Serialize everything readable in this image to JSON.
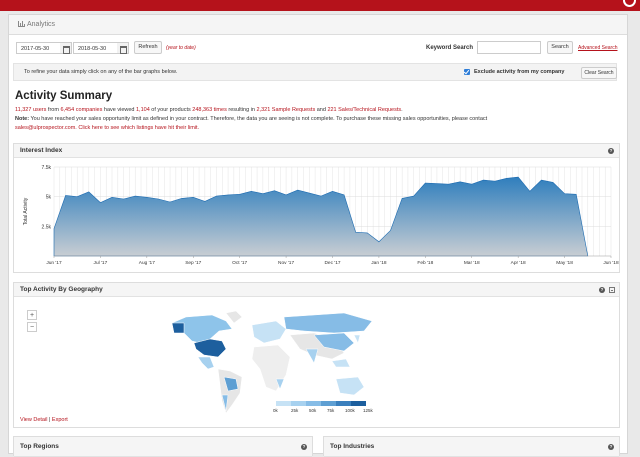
{
  "header": {
    "title": "Analytics"
  },
  "filters": {
    "start_date": "2017-05-30",
    "end_date": "2018-05-30",
    "refresh_label": "Refresh",
    "year_to_date": "(year to date)",
    "keyword_label": "Keyword Search",
    "keyword_value": "",
    "search_label": "Search",
    "advanced_search": "Advanced Search"
  },
  "notice": {
    "text": "To refine your data simply click on any of the bar graphs below.",
    "exclude_label": "Exclude activity from my company",
    "exclude_checked": true,
    "clear_label": "Clear Search"
  },
  "summary": {
    "title": "Activity Summary",
    "users": "11,327 users",
    "t1": " from ",
    "companies": "6,454 companies",
    "t2": " have viewed ",
    "products": "1,104",
    "t3": " of your products ",
    "times": "248,363 times",
    "t4": " resulting in ",
    "samples": "2,321 Sample Requests",
    "t5": " and ",
    "sales": "221 Sales/Technical Requests",
    "t6": ".",
    "note_label": "Note:",
    "note_text": " You have reached your sales opportunity limit as defined in your contract. Therefore, the data you are seeing is not complete. To purchase these missing sales opportunities, please contact",
    "contact": "sales@ulprospector.com. Click here to see which listings have hit their limit."
  },
  "interest": {
    "title": "Interest Index",
    "help": "?"
  },
  "chart_data": {
    "type": "area",
    "title": "Interest Index",
    "ylabel": "Total Activity",
    "xlabel": "",
    "ylim": [
      0,
      7500
    ],
    "yticks": [
      "2.5k",
      "5k",
      "7.5k"
    ],
    "xticks": [
      "Jun '17",
      "Jul '17",
      "Aug '17",
      "Sep '17",
      "Oct '17",
      "Nov '17",
      "Dec '17",
      "Jan '18",
      "Feb '18",
      "Mar '18",
      "Apr '18",
      "May '18",
      "Jun '18"
    ],
    "x_index_range": [
      0,
      12
    ],
    "points": [
      [
        0.0,
        2300
      ],
      [
        0.25,
        5100
      ],
      [
        0.5,
        5000
      ],
      [
        0.75,
        5400
      ],
      [
        1.0,
        4500
      ],
      [
        1.25,
        4950
      ],
      [
        1.5,
        4800
      ],
      [
        1.75,
        5050
      ],
      [
        2.0,
        4950
      ],
      [
        2.25,
        4800
      ],
      [
        2.5,
        4550
      ],
      [
        2.75,
        4850
      ],
      [
        3.0,
        4950
      ],
      [
        3.25,
        4600
      ],
      [
        3.5,
        5050
      ],
      [
        3.75,
        5150
      ],
      [
        4.0,
        5200
      ],
      [
        4.25,
        5450
      ],
      [
        4.5,
        5250
      ],
      [
        4.75,
        5500
      ],
      [
        5.0,
        5150
      ],
      [
        5.25,
        5550
      ],
      [
        5.5,
        5300
      ],
      [
        5.75,
        5050
      ],
      [
        6.0,
        5450
      ],
      [
        6.25,
        5150
      ],
      [
        6.5,
        2000
      ],
      [
        6.75,
        1950
      ],
      [
        7.0,
        1200
      ],
      [
        7.25,
        2150
      ],
      [
        7.5,
        4850
      ],
      [
        7.75,
        5050
      ],
      [
        8.0,
        6150
      ],
      [
        8.25,
        6100
      ],
      [
        8.5,
        6050
      ],
      [
        8.75,
        6250
      ],
      [
        9.0,
        6050
      ],
      [
        9.25,
        6400
      ],
      [
        9.5,
        6300
      ],
      [
        9.75,
        6550
      ],
      [
        10.0,
        6650
      ],
      [
        10.25,
        5450
      ],
      [
        10.5,
        6400
      ],
      [
        10.75,
        6200
      ],
      [
        11.0,
        5250
      ],
      [
        11.25,
        5200
      ],
      [
        11.5,
        0
      ]
    ],
    "color_top": "#2f7ebd",
    "color_bottom": "#c8cdd3"
  },
  "geo": {
    "title": "Top Activity By Geography",
    "help": "?",
    "zoom_in": "+",
    "zoom_out": "−",
    "legend_ticks": [
      "0k",
      "25k",
      "50k",
      "75k",
      "100k",
      "125k"
    ],
    "legend_colors": [
      "#c6e2f5",
      "#a7d1ef",
      "#86bce6",
      "#5e9fd3",
      "#3a7fbd",
      "#1d5f9e"
    ],
    "view_detail": "View Detail",
    "separator": "|",
    "export": "Export"
  },
  "bottom": {
    "regions_title": "Top Regions",
    "industries_title": "Top Industries",
    "help": "?"
  }
}
